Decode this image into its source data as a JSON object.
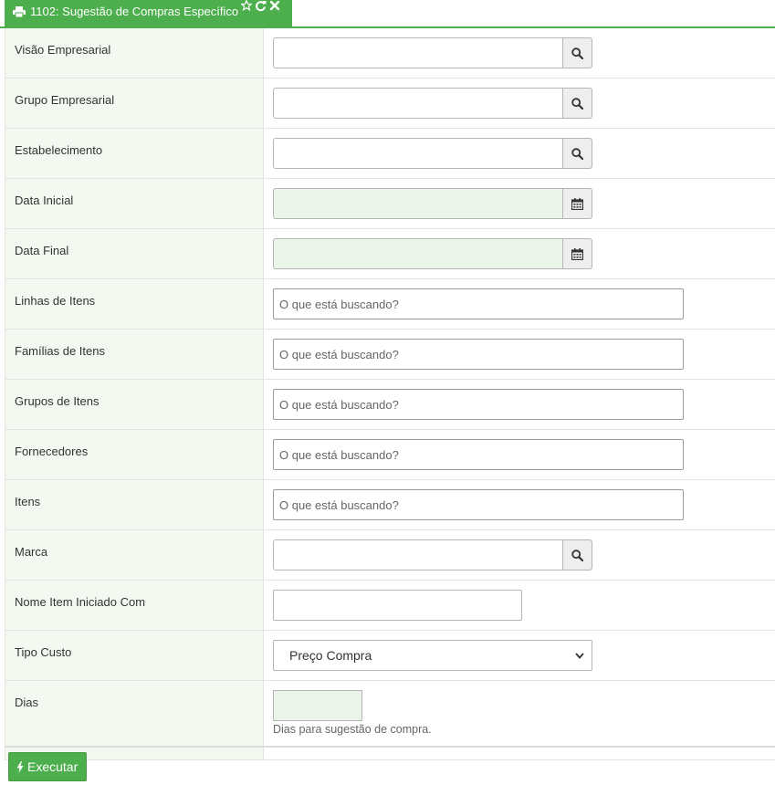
{
  "tab": {
    "title": "1102: Sugestão de Compras Específico",
    "icons": [
      "print-icon",
      "star-icon",
      "refresh-icon",
      "close-icon"
    ]
  },
  "fields": {
    "visao": {
      "label": "Visão Empresarial"
    },
    "grupo_emp": {
      "label": "Grupo Empresarial"
    },
    "estabelecimento": {
      "label": "Estabelecimento"
    },
    "data_inicial": {
      "label": "Data Inicial"
    },
    "data_final": {
      "label": "Data Final"
    },
    "linhas": {
      "label": "Linhas de Itens",
      "placeholder": "O que está buscando?"
    },
    "familias": {
      "label": "Famílias de Itens",
      "placeholder": "O que está buscando?"
    },
    "grupos": {
      "label": "Grupos de Itens",
      "placeholder": "O que está buscando?"
    },
    "fornecedores": {
      "label": "Fornecedores",
      "placeholder": "O que está buscando?"
    },
    "itens": {
      "label": "Itens",
      "placeholder": "O que está buscando?"
    },
    "marca": {
      "label": "Marca"
    },
    "nome_item": {
      "label": "Nome Item Iniciado Com"
    },
    "tipo_custo": {
      "label": "Tipo Custo",
      "value": "Preço Compra"
    },
    "dias": {
      "label": "Dias",
      "help": "Dias para sugestão de compra."
    }
  },
  "footer": {
    "execute_label": "Executar"
  },
  "colors": {
    "accent": "#4cae4c",
    "label_bg": "#f3f9f1",
    "date_bg": "#ebf5e9"
  }
}
